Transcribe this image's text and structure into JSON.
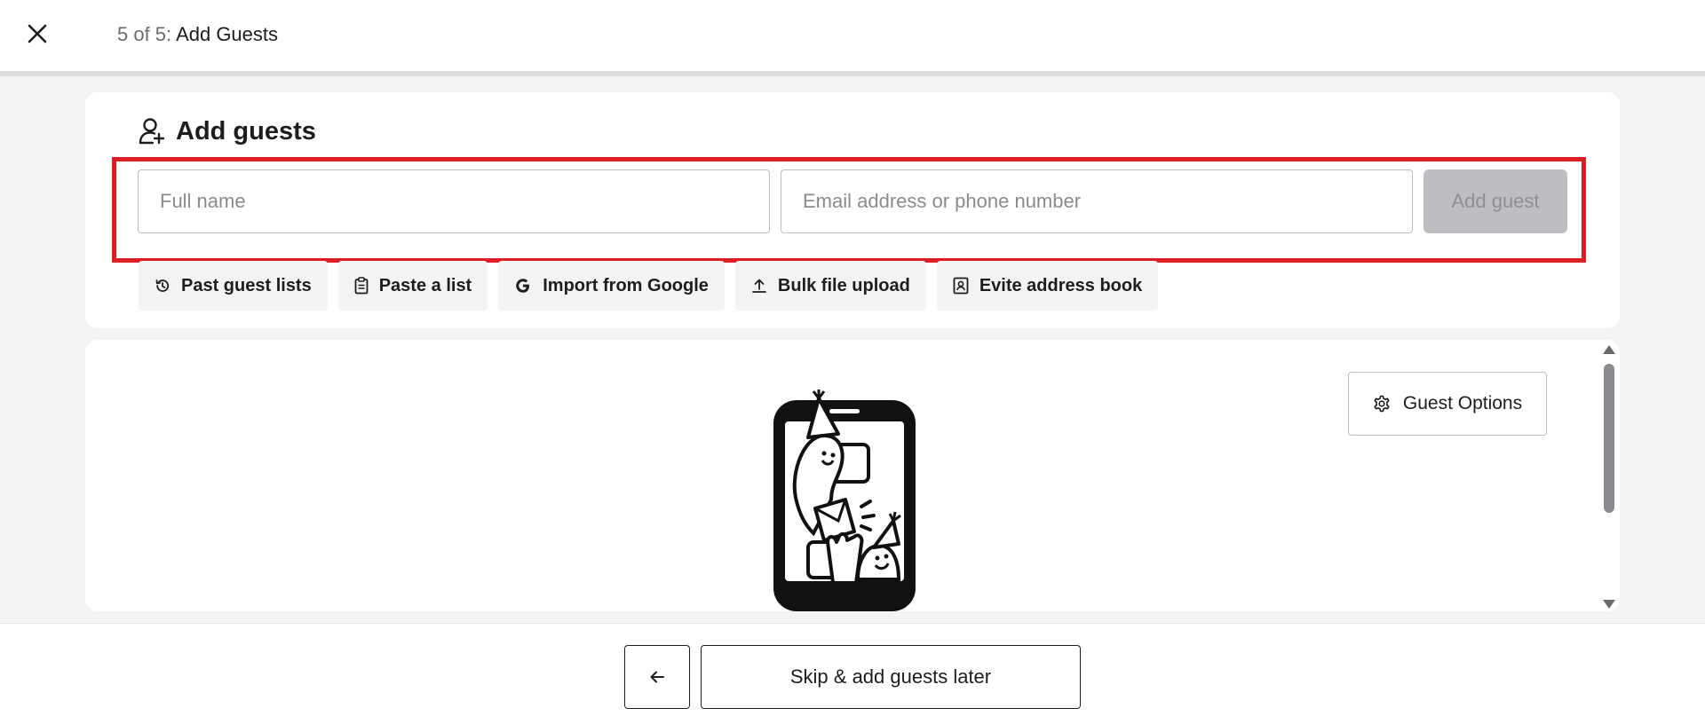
{
  "header": {
    "step_count": "5 of 5:",
    "step_title": "Add Guests"
  },
  "add_guests": {
    "title": "Add guests",
    "full_name_placeholder": "Full name",
    "contact_placeholder": "Email address or phone number",
    "add_button_label": "Add guest",
    "options": [
      {
        "label": "Past guest lists",
        "icon": "history-icon"
      },
      {
        "label": "Paste a list",
        "icon": "clipboard-icon"
      },
      {
        "label": "Import from Google",
        "icon": "google-icon"
      },
      {
        "label": "Bulk file upload",
        "icon": "upload-icon"
      },
      {
        "label": "Evite address book",
        "icon": "address-book-icon"
      }
    ]
  },
  "guest_list": {
    "options_button_label": "Guest Options"
  },
  "footer": {
    "skip_label": "Skip & add guests later"
  },
  "colors": {
    "highlight": "#dc1f26",
    "disabled_button": "#bdbec1",
    "page_background": "#f3f3f4"
  }
}
